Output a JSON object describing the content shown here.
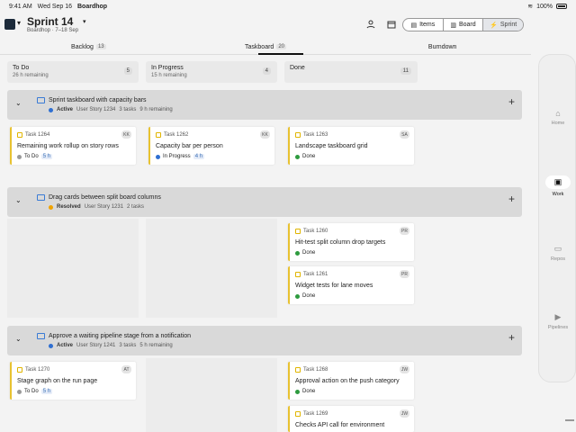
{
  "status": {
    "time": "9:41 AM",
    "date": "Wed Sep 16",
    "app": "Boardhop",
    "battery": "100%"
  },
  "header": {
    "title": "Sprint 14",
    "subtitle": "Boardhop · 7–18 Sep",
    "views": [
      "Items",
      "Board",
      "Sprint"
    ],
    "active_view": "Sprint"
  },
  "tabs": [
    {
      "label": "Backlog",
      "count": "13"
    },
    {
      "label": "Taskboard",
      "count": "20"
    },
    {
      "label": "Burndown",
      "count": ""
    }
  ],
  "columns": [
    {
      "name": "To Do",
      "remaining": "26 h remaining",
      "count": "5"
    },
    {
      "name": "In Progress",
      "remaining": "15 h remaining",
      "count": "4"
    },
    {
      "name": "Done",
      "remaining": "",
      "count": "11"
    }
  ],
  "stories": [
    {
      "title": "Sprint taskboard with capacity bars",
      "status": "Active",
      "status_color": "#2f6fd1",
      "story": "User Story 1234",
      "tasks": "3 tasks",
      "remaining": "9 h remaining"
    },
    {
      "title": "Drag cards between split board columns",
      "status": "Resolved",
      "status_color": "#f0a300",
      "story": "User Story 1231",
      "tasks": "2 tasks",
      "remaining": ""
    },
    {
      "title": "Approve a waiting pipeline stage from a notification",
      "status": "Active",
      "status_color": "#2f6fd1",
      "story": "User Story 1241",
      "tasks": "3 tasks",
      "remaining": "5 h remaining"
    }
  ],
  "cards": [
    {
      "id": "Task 1264",
      "title": "Remaining work rollup on story rows",
      "state": "To Do",
      "state_color": "#9a9a9a",
      "hours": "5 h",
      "assignee": "KK"
    },
    {
      "id": "Task 1262",
      "title": "Capacity bar per person",
      "state": "In Progress",
      "state_color": "#2f6fd1",
      "hours": "4 h",
      "assignee": "KK"
    },
    {
      "id": "Task 1263",
      "title": "Landscape taskboard grid",
      "state": "Done",
      "state_color": "#2e9b3f",
      "hours": "",
      "assignee": "SA"
    },
    {
      "id": "Task 1260",
      "title": "Hit-test split column drop targets",
      "state": "Done",
      "state_color": "#2e9b3f",
      "hours": "",
      "assignee": "PR"
    },
    {
      "id": "Task 1261",
      "title": "Widget tests for lane moves",
      "state": "Done",
      "state_color": "#2e9b3f",
      "hours": "",
      "assignee": "PR"
    },
    {
      "id": "Task 1270",
      "title": "Stage graph on the run page",
      "state": "To Do",
      "state_color": "#9a9a9a",
      "hours": "5 h",
      "assignee": "AT"
    },
    {
      "id": "Task 1268",
      "title": "Approval action on the push category",
      "state": "Done",
      "state_color": "#2e9b3f",
      "hours": "",
      "assignee": "JW"
    },
    {
      "id": "Task 1269",
      "title": "Checks API call for environment",
      "state": "",
      "state_color": "",
      "hours": "",
      "assignee": "JW"
    }
  ],
  "sidebar": [
    {
      "label": "Home",
      "icon": "home-icon"
    },
    {
      "label": "Work",
      "icon": "clipboard-icon"
    },
    {
      "label": "Repos",
      "icon": "folder-icon"
    },
    {
      "label": "Pipelines",
      "icon": "play-icon"
    }
  ]
}
